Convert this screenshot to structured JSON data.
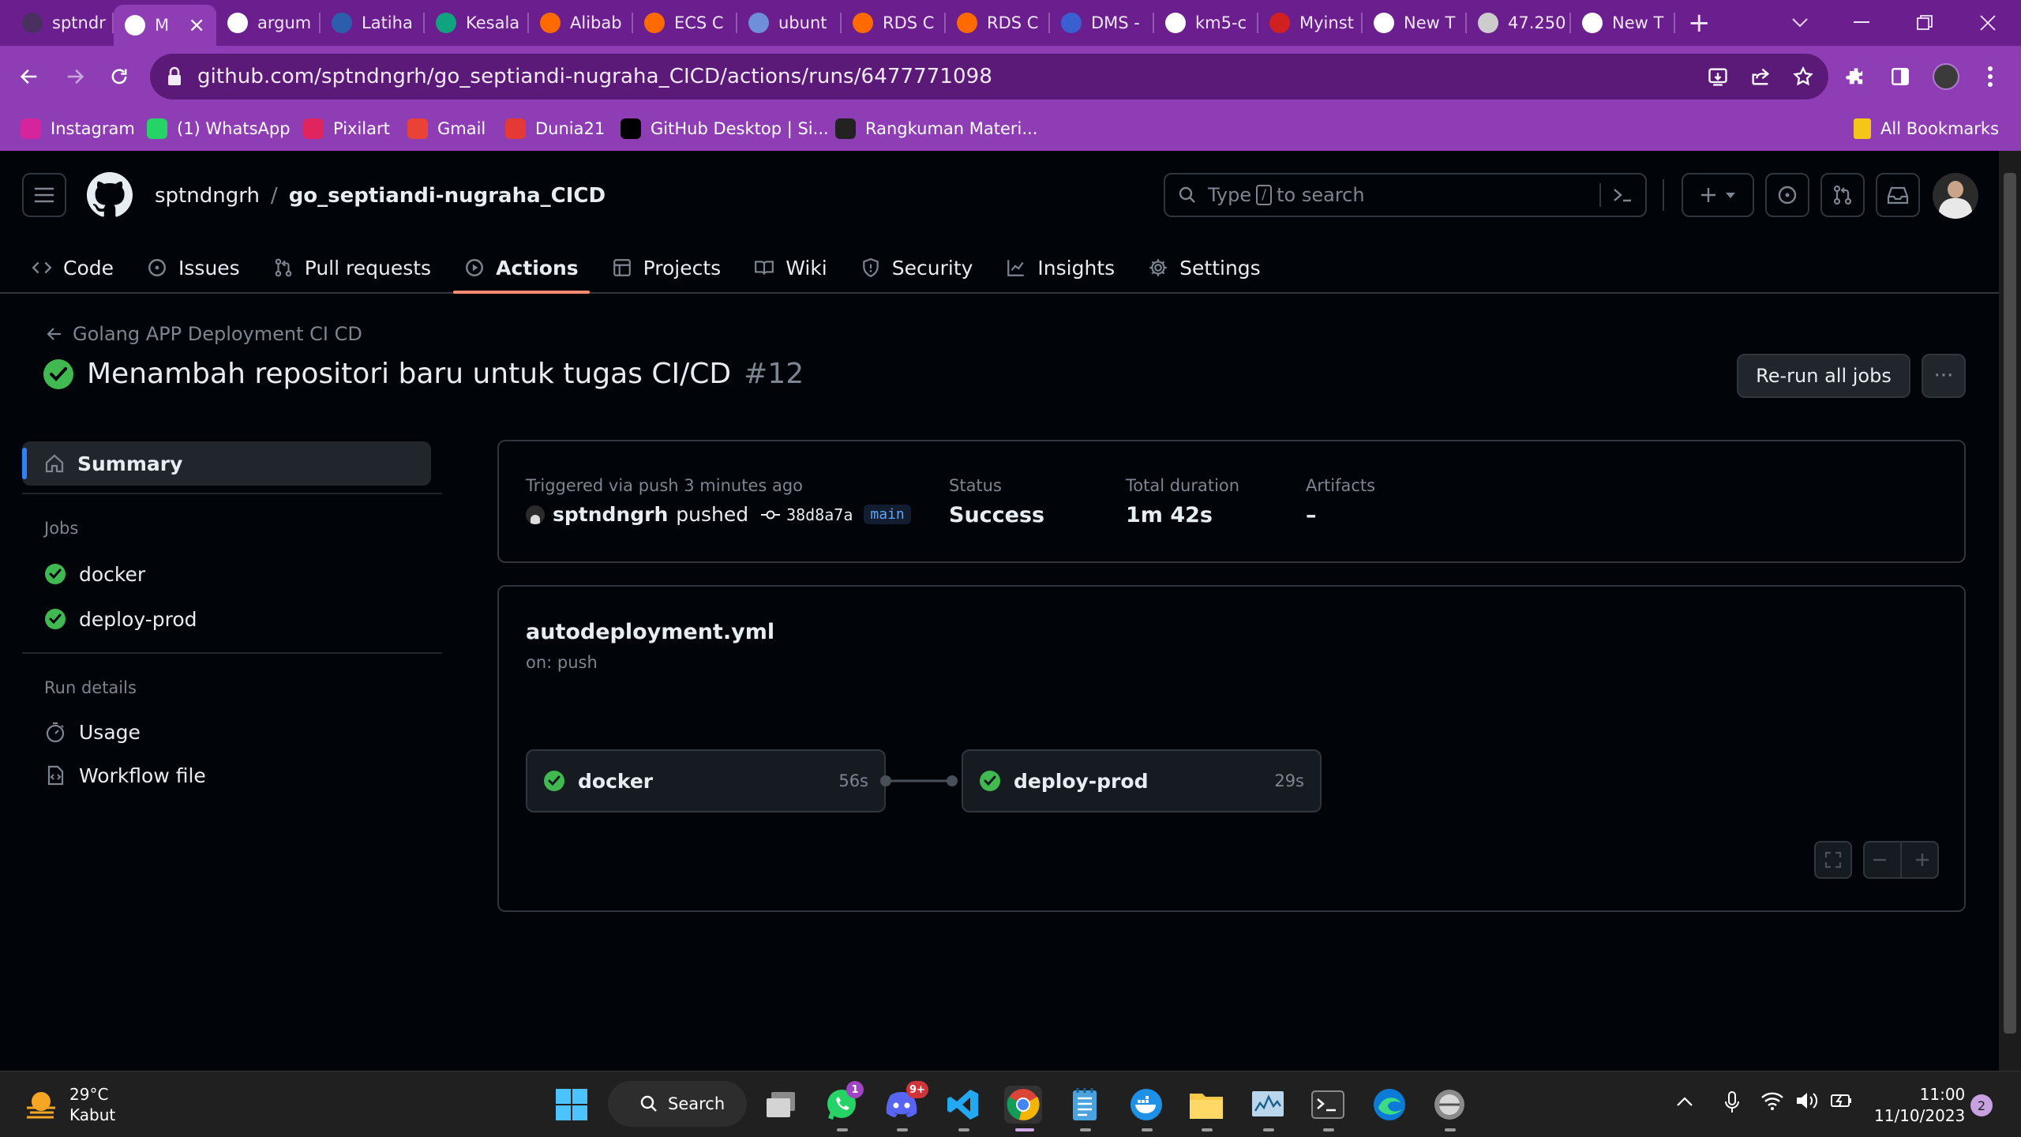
{
  "browser": {
    "tabs": [
      {
        "title": "sptndr",
        "icon": "github-icon",
        "color": "#4a3060"
      },
      {
        "title": "M",
        "icon": "github-icon",
        "color": "#ffffff",
        "active": true
      },
      {
        "title": "argum",
        "icon": "google-icon",
        "color": "#ffffff"
      },
      {
        "title": "Latiha",
        "icon": "app-icon",
        "color": "#2b5fad"
      },
      {
        "title": "Kesala",
        "icon": "chatgpt-icon",
        "color": "#10a37f"
      },
      {
        "title": "Alibab",
        "icon": "alibaba-icon",
        "color": "#ff6a00"
      },
      {
        "title": "ECS C",
        "icon": "alibaba-icon",
        "color": "#ff6a00"
      },
      {
        "title": "ubunt",
        "icon": "terminal-icon",
        "color": "#6f8fd8"
      },
      {
        "title": "RDS C",
        "icon": "alibaba-icon",
        "color": "#ff6a00"
      },
      {
        "title": "RDS C",
        "icon": "alibaba-icon",
        "color": "#ff6a00"
      },
      {
        "title": "DMS -",
        "icon": "dms-icon",
        "color": "#3a5fd0"
      },
      {
        "title": "km5-c",
        "icon": "github-icon",
        "color": "#ffffff"
      },
      {
        "title": "Myinst",
        "icon": "record-icon",
        "color": "#d02020"
      },
      {
        "title": "New T",
        "icon": "chrome-icon",
        "color": "#ffffff"
      },
      {
        "title": "47.250",
        "icon": "globe-icon",
        "color": "#cccccc"
      },
      {
        "title": "New T",
        "icon": "chrome-icon",
        "color": "#ffffff"
      }
    ],
    "new_tab": "+",
    "url": "github.com/sptndngrh/go_septiandi-nugraha_CICD/actions/runs/6477771098",
    "bookmarks": [
      {
        "label": "Instagram",
        "icon": "instagram-icon",
        "color": "#d6249f"
      },
      {
        "label": "(1) WhatsApp",
        "icon": "whatsapp-icon",
        "color": "#25d366"
      },
      {
        "label": "Pixilart",
        "icon": "heart-icon",
        "color": "#e0245e"
      },
      {
        "label": "Gmail",
        "icon": "gmail-icon",
        "color": "#ea4335"
      },
      {
        "label": "Dunia21",
        "icon": "dunia21-icon",
        "color": "#e53935"
      },
      {
        "label": "GitHub Desktop | Si...",
        "icon": "github-icon",
        "color": "#000000"
      },
      {
        "label": "Rangkuman Materi...",
        "icon": "g-icon",
        "color": "#222222"
      }
    ],
    "all_bookmarks": "All Bookmarks"
  },
  "github": {
    "owner": "sptndngrh",
    "separator": "/",
    "repo": "go_septiandi-nugraha_CICD",
    "search_prefix": "Type",
    "search_key": "/",
    "search_suffix": "to search",
    "nav": [
      {
        "label": "Code",
        "icon": "code-icon"
      },
      {
        "label": "Issues",
        "icon": "issue-icon"
      },
      {
        "label": "Pull requests",
        "icon": "pull-request-icon"
      },
      {
        "label": "Actions",
        "icon": "play-icon",
        "selected": true
      },
      {
        "label": "Projects",
        "icon": "table-icon"
      },
      {
        "label": "Wiki",
        "icon": "book-icon"
      },
      {
        "label": "Security",
        "icon": "shield-icon"
      },
      {
        "label": "Insights",
        "icon": "graph-icon"
      },
      {
        "label": "Settings",
        "icon": "gear-icon"
      }
    ]
  },
  "run": {
    "workflow_name": "Golang APP Deployment CI CD",
    "title": "Menambah repositori baru untuk tugas CI/CD",
    "number": "#12",
    "rerun_label": "Re-run all jobs",
    "more_label": "···"
  },
  "sidebar": {
    "summary": "Summary",
    "jobs_heading": "Jobs",
    "jobs": [
      "docker",
      "deploy-prod"
    ],
    "details_heading": "Run details",
    "details": [
      "Usage",
      "Workflow file"
    ]
  },
  "summary": {
    "trigger_label": "Triggered via push 3 minutes ago",
    "actor": "sptndngrh",
    "action": "pushed",
    "commit": "38d8a7a",
    "branch": "main",
    "status_label": "Status",
    "status_value": "Success",
    "duration_label": "Total duration",
    "duration_value": "1m 42s",
    "artifacts_label": "Artifacts",
    "artifacts_value": "–"
  },
  "graph": {
    "file": "autodeployment.yml",
    "trigger": "on: push",
    "jobs": [
      {
        "name": "docker",
        "duration": "56s"
      },
      {
        "name": "deploy-prod",
        "duration": "29s"
      }
    ]
  },
  "taskbar": {
    "weather_temp": "29°C",
    "weather_desc": "Kabut",
    "search_label": "Search",
    "whatsapp_badge": "1",
    "discord_badge": "9+",
    "time": "11:00",
    "date": "11/10/2023",
    "notification_count": "2"
  },
  "colors": {
    "success": "#3fb950",
    "accent": "#2f81f7",
    "underline": "#fd8c73",
    "browser_frame": "#8f3db5"
  }
}
